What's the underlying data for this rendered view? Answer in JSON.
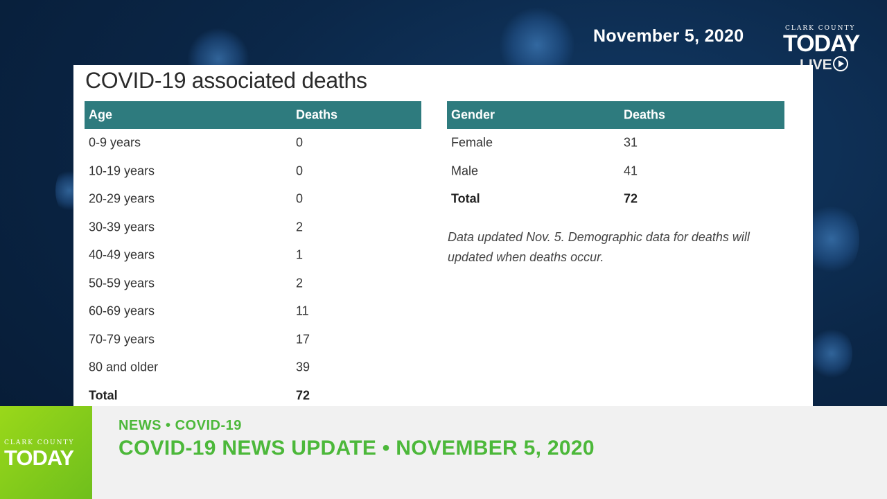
{
  "broadcast": {
    "date": "November 5, 2020",
    "logo": {
      "top_line": "CLARK COUNTY",
      "wordmark": "TODAY",
      "live": "LIVE"
    }
  },
  "panel": {
    "title": "COVID-19 associated deaths",
    "age_table": {
      "headers": [
        "Age",
        "Deaths"
      ],
      "rows": [
        [
          "0-9 years",
          "0"
        ],
        [
          "10-19 years",
          "0"
        ],
        [
          "20-29 years",
          "0"
        ],
        [
          "30-39 years",
          "2"
        ],
        [
          "40-49 years",
          "1"
        ],
        [
          "50-59 years",
          "2"
        ],
        [
          "60-69 years",
          "11"
        ],
        [
          "70-79 years",
          "17"
        ],
        [
          "80 and older",
          "39"
        ]
      ],
      "total": [
        "Total",
        "72"
      ]
    },
    "gender_table": {
      "headers": [
        "Gender",
        "Deaths"
      ],
      "rows": [
        [
          "Female",
          "31"
        ],
        [
          "Male",
          "41"
        ]
      ],
      "total": [
        "Total",
        "72"
      ]
    },
    "note": "Data updated Nov. 5. Demographic data for deaths will updated when deaths occur."
  },
  "lower_third": {
    "logo": {
      "top_line": "CLARK COUNTY",
      "wordmark": "TODAY"
    },
    "kicker": "NEWS • COVID-19",
    "headline": "COVID-19 NEWS UPDATE • NOVEMBER 5, 2020"
  },
  "colors": {
    "table_header": "#2e7b7e",
    "accent_green": "#4cb83a",
    "background_navy": "#0b2748"
  }
}
